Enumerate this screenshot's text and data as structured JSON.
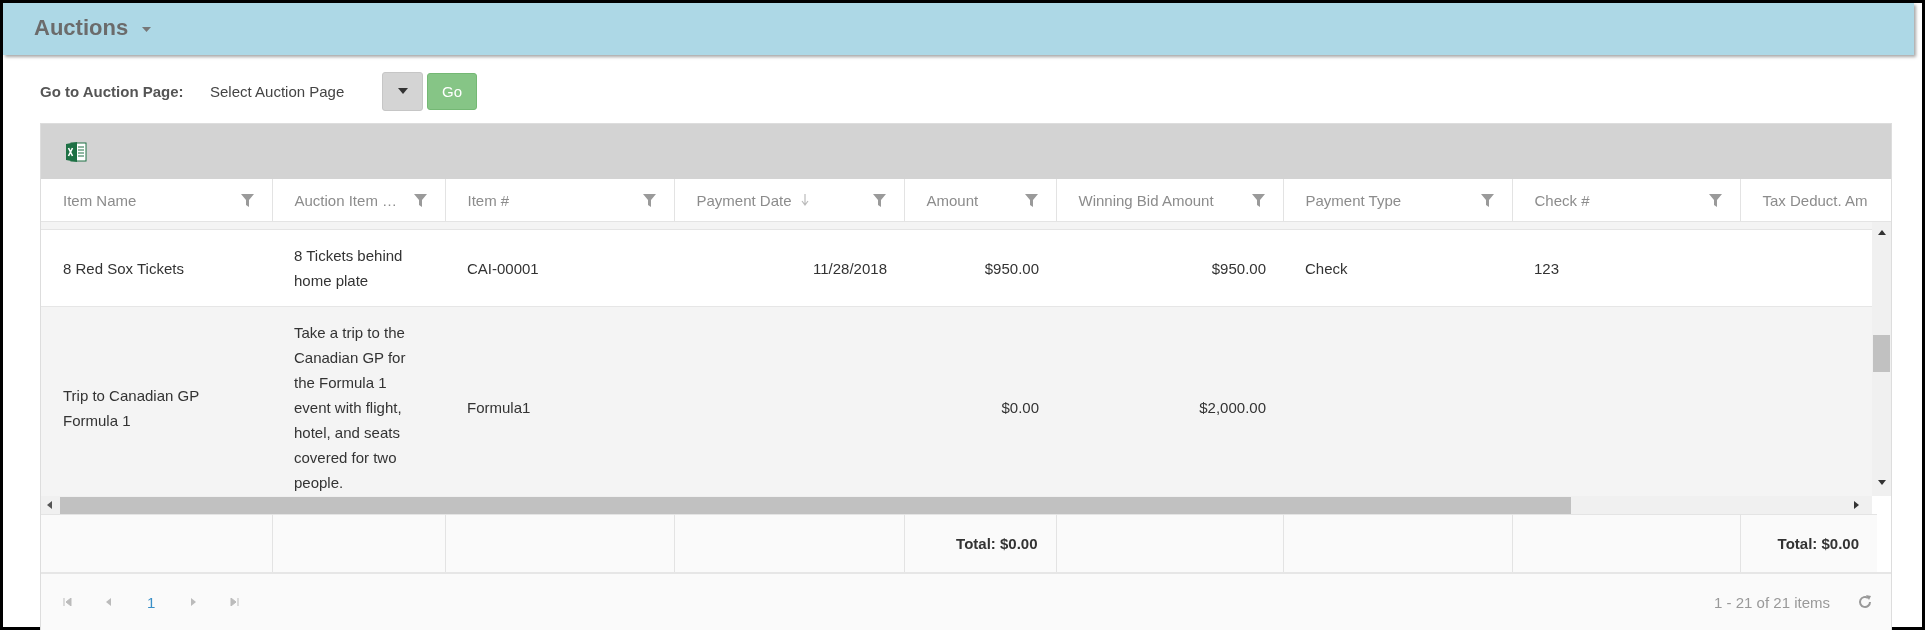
{
  "header": {
    "title": "Auctions",
    "has_menu": true
  },
  "page_picker": {
    "label": "Go to Auction Page:",
    "placeholder": "Select Auction Page",
    "button": "Go"
  },
  "grid": {
    "columns": [
      {
        "label": "Item Name",
        "kind": "text",
        "sorted": false,
        "filterable": true
      },
      {
        "label": "Auction Item …",
        "kind": "text",
        "sorted": false,
        "filterable": true
      },
      {
        "label": "Item #",
        "kind": "text",
        "sorted": false,
        "filterable": true
      },
      {
        "label": "Payment Date",
        "kind": "number",
        "sorted": true,
        "filterable": true
      },
      {
        "label": "Amount",
        "kind": "number",
        "sorted": false,
        "filterable": true,
        "total": "Total: $0.00"
      },
      {
        "label": "Winning Bid Amount",
        "kind": "number",
        "sorted": false,
        "filterable": true
      },
      {
        "label": "Payment Type",
        "kind": "text",
        "sorted": false,
        "filterable": true
      },
      {
        "label": "Check #",
        "kind": "text",
        "sorted": false,
        "filterable": true
      },
      {
        "label": "Tax Deduct. Am",
        "kind": "number",
        "total": "Total: $0.00"
      }
    ],
    "rows": [
      {
        "item_name": "8 Red Sox Tickets",
        "description": "8 Tickets behind home plate",
        "item_no": "CAI-00001",
        "payment_date": "11/28/2018",
        "amount": "$950.00",
        "winning_bid": "$950.00",
        "payment_type": "Check",
        "check_no": "123"
      },
      {
        "item_name": "Trip to Canadian GP Formula 1",
        "description": "Take a trip to the Canadian GP for the Formula 1 event with flight, hotel, and seats covered for two people.",
        "item_no": "Formula1",
        "amount": "$0.00",
        "winning_bid": "$2,000.00"
      }
    ]
  },
  "pager": {
    "pages": [
      {
        "label": "1",
        "selected": true
      }
    ],
    "info": "1 - 21 of 21 items"
  }
}
